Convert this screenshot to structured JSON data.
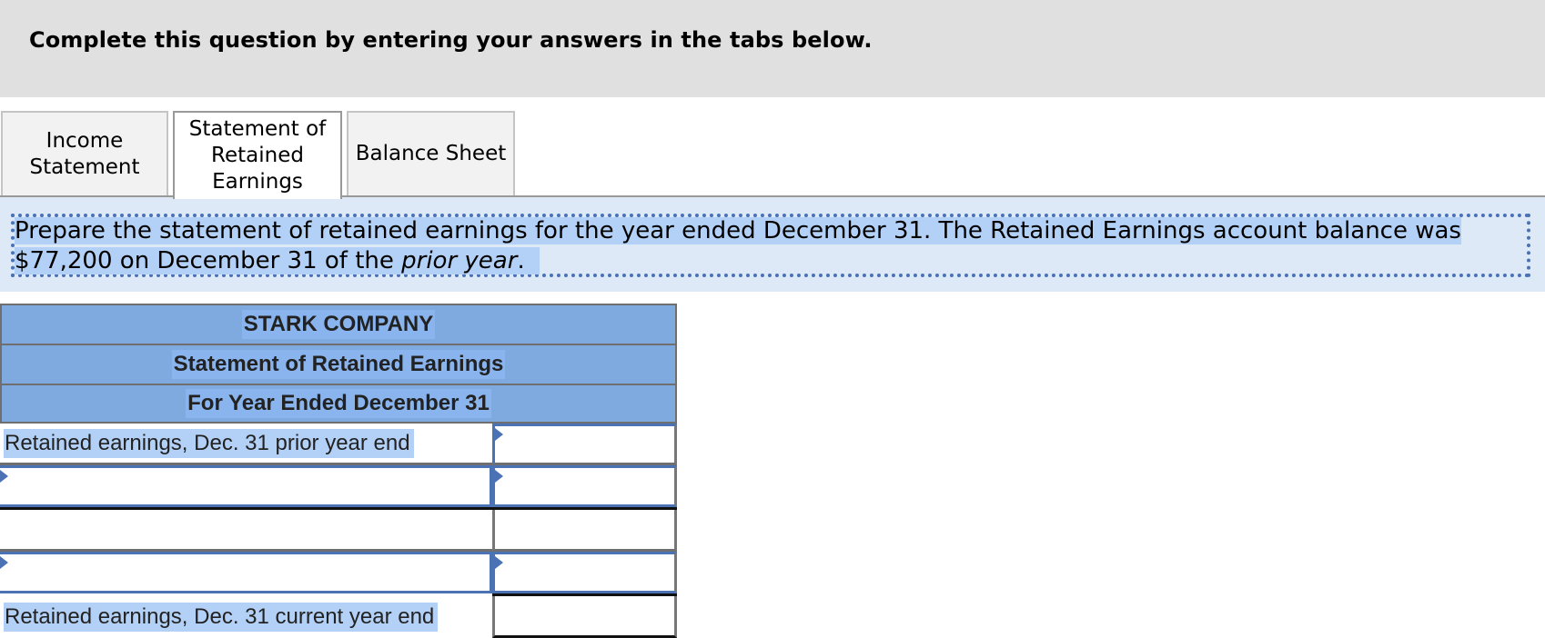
{
  "banner": {
    "title": "Complete this question by entering your answers in the tabs below."
  },
  "tabs": [
    {
      "label": "Income Statement",
      "active": false
    },
    {
      "label": "Statement of Retained Earnings",
      "active": true
    },
    {
      "label": "Balance Sheet",
      "active": false
    }
  ],
  "instructions": {
    "line1": "Prepare the statement of retained earnings for the year ended December 31. The Retained Earnings account balance was",
    "line2_prefix": "$77,200 on December 31 of the ",
    "line2_italic": "prior year",
    "line2_suffix": "."
  },
  "statement": {
    "company": "STARK COMPANY",
    "title": "Statement of Retained Earnings",
    "period": "For Year Ended December 31",
    "rows": [
      {
        "label": "Retained earnings, Dec. 31 prior year end",
        "label_editable": false,
        "amount": "",
        "amount_editable": true
      },
      {
        "label": "",
        "label_editable": true,
        "amount": "",
        "amount_editable": true
      },
      {
        "label": "",
        "label_editable": false,
        "amount": "",
        "amount_editable": false
      },
      {
        "label": "",
        "label_editable": true,
        "amount": "",
        "amount_editable": true
      },
      {
        "label": "Retained earnings, Dec. 31 current year end",
        "label_editable": false,
        "amount": "",
        "amount_editable": false
      }
    ]
  },
  "colors": {
    "header_fill": "#7eaae0",
    "input_border": "#4a72b5",
    "selection_highlight": "#b3d1f7",
    "instruction_band": "#dde9f7",
    "banner": "#e0e0e0"
  }
}
